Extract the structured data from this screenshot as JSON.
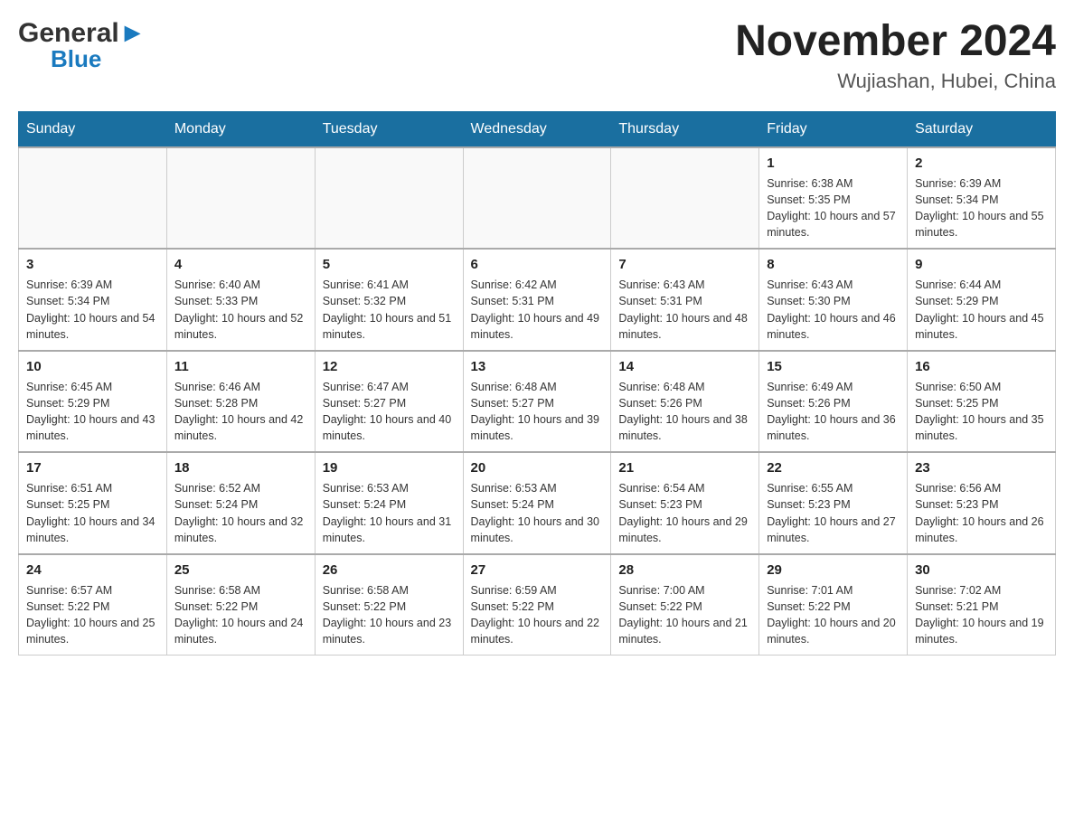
{
  "header": {
    "logo_general": "General",
    "logo_blue": "Blue",
    "month_title": "November 2024",
    "location": "Wujiashan, Hubei, China"
  },
  "weekdays": [
    "Sunday",
    "Monday",
    "Tuesday",
    "Wednesday",
    "Thursday",
    "Friday",
    "Saturday"
  ],
  "weeks": [
    [
      {
        "day": "",
        "info": ""
      },
      {
        "day": "",
        "info": ""
      },
      {
        "day": "",
        "info": ""
      },
      {
        "day": "",
        "info": ""
      },
      {
        "day": "",
        "info": ""
      },
      {
        "day": "1",
        "info": "Sunrise: 6:38 AM\nSunset: 5:35 PM\nDaylight: 10 hours and 57 minutes."
      },
      {
        "day": "2",
        "info": "Sunrise: 6:39 AM\nSunset: 5:34 PM\nDaylight: 10 hours and 55 minutes."
      }
    ],
    [
      {
        "day": "3",
        "info": "Sunrise: 6:39 AM\nSunset: 5:34 PM\nDaylight: 10 hours and 54 minutes."
      },
      {
        "day": "4",
        "info": "Sunrise: 6:40 AM\nSunset: 5:33 PM\nDaylight: 10 hours and 52 minutes."
      },
      {
        "day": "5",
        "info": "Sunrise: 6:41 AM\nSunset: 5:32 PM\nDaylight: 10 hours and 51 minutes."
      },
      {
        "day": "6",
        "info": "Sunrise: 6:42 AM\nSunset: 5:31 PM\nDaylight: 10 hours and 49 minutes."
      },
      {
        "day": "7",
        "info": "Sunrise: 6:43 AM\nSunset: 5:31 PM\nDaylight: 10 hours and 48 minutes."
      },
      {
        "day": "8",
        "info": "Sunrise: 6:43 AM\nSunset: 5:30 PM\nDaylight: 10 hours and 46 minutes."
      },
      {
        "day": "9",
        "info": "Sunrise: 6:44 AM\nSunset: 5:29 PM\nDaylight: 10 hours and 45 minutes."
      }
    ],
    [
      {
        "day": "10",
        "info": "Sunrise: 6:45 AM\nSunset: 5:29 PM\nDaylight: 10 hours and 43 minutes."
      },
      {
        "day": "11",
        "info": "Sunrise: 6:46 AM\nSunset: 5:28 PM\nDaylight: 10 hours and 42 minutes."
      },
      {
        "day": "12",
        "info": "Sunrise: 6:47 AM\nSunset: 5:27 PM\nDaylight: 10 hours and 40 minutes."
      },
      {
        "day": "13",
        "info": "Sunrise: 6:48 AM\nSunset: 5:27 PM\nDaylight: 10 hours and 39 minutes."
      },
      {
        "day": "14",
        "info": "Sunrise: 6:48 AM\nSunset: 5:26 PM\nDaylight: 10 hours and 38 minutes."
      },
      {
        "day": "15",
        "info": "Sunrise: 6:49 AM\nSunset: 5:26 PM\nDaylight: 10 hours and 36 minutes."
      },
      {
        "day": "16",
        "info": "Sunrise: 6:50 AM\nSunset: 5:25 PM\nDaylight: 10 hours and 35 minutes."
      }
    ],
    [
      {
        "day": "17",
        "info": "Sunrise: 6:51 AM\nSunset: 5:25 PM\nDaylight: 10 hours and 34 minutes."
      },
      {
        "day": "18",
        "info": "Sunrise: 6:52 AM\nSunset: 5:24 PM\nDaylight: 10 hours and 32 minutes."
      },
      {
        "day": "19",
        "info": "Sunrise: 6:53 AM\nSunset: 5:24 PM\nDaylight: 10 hours and 31 minutes."
      },
      {
        "day": "20",
        "info": "Sunrise: 6:53 AM\nSunset: 5:24 PM\nDaylight: 10 hours and 30 minutes."
      },
      {
        "day": "21",
        "info": "Sunrise: 6:54 AM\nSunset: 5:23 PM\nDaylight: 10 hours and 29 minutes."
      },
      {
        "day": "22",
        "info": "Sunrise: 6:55 AM\nSunset: 5:23 PM\nDaylight: 10 hours and 27 minutes."
      },
      {
        "day": "23",
        "info": "Sunrise: 6:56 AM\nSunset: 5:23 PM\nDaylight: 10 hours and 26 minutes."
      }
    ],
    [
      {
        "day": "24",
        "info": "Sunrise: 6:57 AM\nSunset: 5:22 PM\nDaylight: 10 hours and 25 minutes."
      },
      {
        "day": "25",
        "info": "Sunrise: 6:58 AM\nSunset: 5:22 PM\nDaylight: 10 hours and 24 minutes."
      },
      {
        "day": "26",
        "info": "Sunrise: 6:58 AM\nSunset: 5:22 PM\nDaylight: 10 hours and 23 minutes."
      },
      {
        "day": "27",
        "info": "Sunrise: 6:59 AM\nSunset: 5:22 PM\nDaylight: 10 hours and 22 minutes."
      },
      {
        "day": "28",
        "info": "Sunrise: 7:00 AM\nSunset: 5:22 PM\nDaylight: 10 hours and 21 minutes."
      },
      {
        "day": "29",
        "info": "Sunrise: 7:01 AM\nSunset: 5:22 PM\nDaylight: 10 hours and 20 minutes."
      },
      {
        "day": "30",
        "info": "Sunrise: 7:02 AM\nSunset: 5:21 PM\nDaylight: 10 hours and 19 minutes."
      }
    ]
  ]
}
